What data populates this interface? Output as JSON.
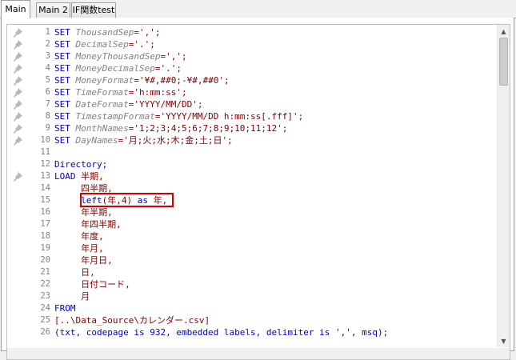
{
  "tabs": [
    {
      "label": "Main",
      "active": true
    },
    {
      "label": "Main 2",
      "active": false
    },
    {
      "label": "IF関数test",
      "active": false
    }
  ],
  "code_lines": [
    {
      "n": "1",
      "pin": true,
      "parts": [
        {
          "t": "SET ",
          "c": "kw"
        },
        {
          "t": "ThousandSep",
          "c": "var"
        },
        {
          "t": "=',';",
          "c": "txt"
        }
      ]
    },
    {
      "n": "2",
      "pin": true,
      "parts": [
        {
          "t": "SET ",
          "c": "kw"
        },
        {
          "t": "DecimalSep",
          "c": "var"
        },
        {
          "t": "='.';",
          "c": "txt"
        }
      ]
    },
    {
      "n": "3",
      "pin": true,
      "parts": [
        {
          "t": "SET ",
          "c": "kw"
        },
        {
          "t": "MoneyThousandSep",
          "c": "var"
        },
        {
          "t": "=',';",
          "c": "txt"
        }
      ]
    },
    {
      "n": "4",
      "pin": true,
      "parts": [
        {
          "t": "SET ",
          "c": "kw"
        },
        {
          "t": "MoneyDecimalSep",
          "c": "var"
        },
        {
          "t": "='.';",
          "c": "txt"
        }
      ]
    },
    {
      "n": "5",
      "pin": true,
      "parts": [
        {
          "t": "SET ",
          "c": "kw"
        },
        {
          "t": "MoneyFormat",
          "c": "var"
        },
        {
          "t": "='¥#,##0;-¥#,##0';",
          "c": "txt"
        }
      ]
    },
    {
      "n": "6",
      "pin": true,
      "parts": [
        {
          "t": "SET ",
          "c": "kw"
        },
        {
          "t": "TimeFormat",
          "c": "var"
        },
        {
          "t": "='h:mm:ss';",
          "c": "txt"
        }
      ]
    },
    {
      "n": "7",
      "pin": true,
      "parts": [
        {
          "t": "SET ",
          "c": "kw"
        },
        {
          "t": "DateFormat",
          "c": "var"
        },
        {
          "t": "='YYYY/MM/DD';",
          "c": "txt"
        }
      ]
    },
    {
      "n": "8",
      "pin": true,
      "parts": [
        {
          "t": "SET ",
          "c": "kw"
        },
        {
          "t": "TimestampFormat",
          "c": "var"
        },
        {
          "t": "='YYYY/MM/DD h:mm:ss[.fff]';",
          "c": "txt"
        }
      ]
    },
    {
      "n": "9",
      "pin": true,
      "parts": [
        {
          "t": "SET ",
          "c": "kw"
        },
        {
          "t": "MonthNames",
          "c": "var"
        },
        {
          "t": "='1;2;3;4;5;6;7;8;9;10;11;12';",
          "c": "txt"
        }
      ]
    },
    {
      "n": "10",
      "pin": true,
      "parts": [
        {
          "t": "SET ",
          "c": "kw"
        },
        {
          "t": "DayNames",
          "c": "var"
        },
        {
          "t": "='月;火;水;木;金;土;日';",
          "c": "txt"
        }
      ]
    },
    {
      "n": "11",
      "pin": false,
      "parts": []
    },
    {
      "n": "12",
      "pin": false,
      "parts": [
        {
          "t": "Directory;",
          "c": "kw"
        }
      ]
    },
    {
      "n": "13",
      "pin": true,
      "parts": [
        {
          "t": "LOAD ",
          "c": "kw"
        },
        {
          "t": "半期,",
          "c": "txt"
        }
      ]
    },
    {
      "n": "14",
      "pin": false,
      "parts": [
        {
          "t": "     四半期,",
          "c": "txt"
        }
      ]
    },
    {
      "n": "15",
      "pin": false,
      "parts": [
        {
          "t": "     ",
          "c": "txt"
        },
        {
          "t": "left",
          "c": "kw"
        },
        {
          "t": "(年,4) ",
          "c": "txt"
        },
        {
          "t": "as",
          "c": "kw"
        },
        {
          "t": " 年,",
          "c": "txt"
        }
      ]
    },
    {
      "n": "16",
      "pin": false,
      "parts": [
        {
          "t": "     年半期,",
          "c": "txt"
        }
      ]
    },
    {
      "n": "17",
      "pin": false,
      "parts": [
        {
          "t": "     年四半期,",
          "c": "txt"
        }
      ]
    },
    {
      "n": "18",
      "pin": false,
      "parts": [
        {
          "t": "     年度,",
          "c": "txt"
        }
      ]
    },
    {
      "n": "19",
      "pin": false,
      "parts": [
        {
          "t": "     年月,",
          "c": "txt"
        }
      ]
    },
    {
      "n": "20",
      "pin": false,
      "parts": [
        {
          "t": "     年月日,",
          "c": "txt"
        }
      ]
    },
    {
      "n": "21",
      "pin": false,
      "parts": [
        {
          "t": "     日,",
          "c": "txt"
        }
      ]
    },
    {
      "n": "22",
      "pin": false,
      "parts": [
        {
          "t": "     日付コード,",
          "c": "txt"
        }
      ]
    },
    {
      "n": "23",
      "pin": false,
      "parts": [
        {
          "t": "     月",
          "c": "txt"
        }
      ]
    },
    {
      "n": "24",
      "pin": false,
      "parts": [
        {
          "t": "FROM",
          "c": "kw"
        }
      ]
    },
    {
      "n": "25",
      "pin": false,
      "parts": [
        {
          "t": "[..\\Data_Source\\カレンダー.csv]",
          "c": "txt"
        }
      ]
    },
    {
      "n": "26",
      "pin": false,
      "parts": [
        {
          "t": "(txt, codepage is 932, embedded labels, delimiter is ',', msq);",
          "c": "kw"
        }
      ]
    }
  ],
  "highlight": {
    "color": "#d00000"
  },
  "colors": {
    "keyword": "#0000cc",
    "variable": "#808080",
    "text": "#800000"
  }
}
